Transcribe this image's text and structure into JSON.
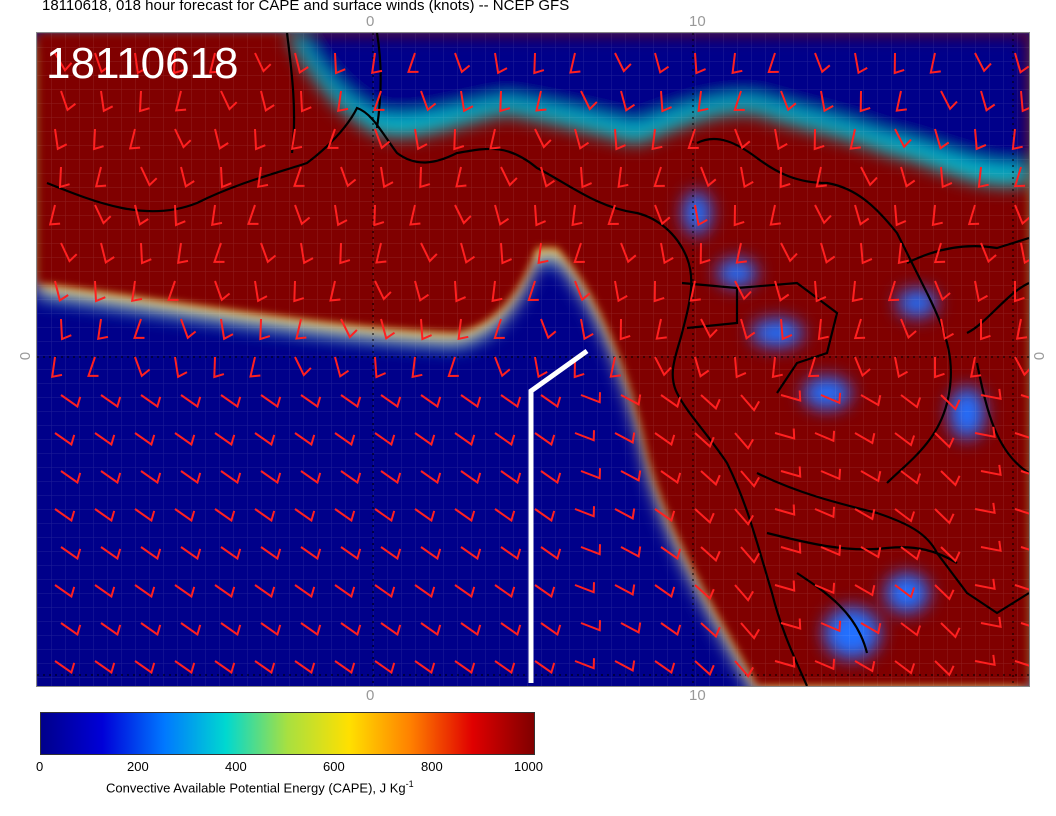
{
  "title": "18110618, 018 hour forecast for CAPE and surface winds (knots) -- NCEP GFS",
  "stamp": "18110618",
  "ticks": {
    "top": [
      "0",
      "10"
    ],
    "bottom": [
      "0",
      "10"
    ],
    "left": [
      "0"
    ],
    "right": [
      "0"
    ]
  },
  "colorbar": {
    "labels": [
      "0",
      "200",
      "400",
      "600",
      "800",
      "1000"
    ],
    "caption": "Convective Available Potential Energy (CAPE), J Kg",
    "caption_exponent": "-1",
    "stops": [
      "#00008b",
      "#0000d8",
      "#0078ff",
      "#00d8d0",
      "#a8e040",
      "#ffe000",
      "#ff8000",
      "#e00000",
      "#800000"
    ]
  },
  "colors": {
    "low_cape": "#000088",
    "high_cape": "#800000",
    "wind_barbs": "#ff2020",
    "coastline": "#000000",
    "track": "#ffffff"
  }
}
